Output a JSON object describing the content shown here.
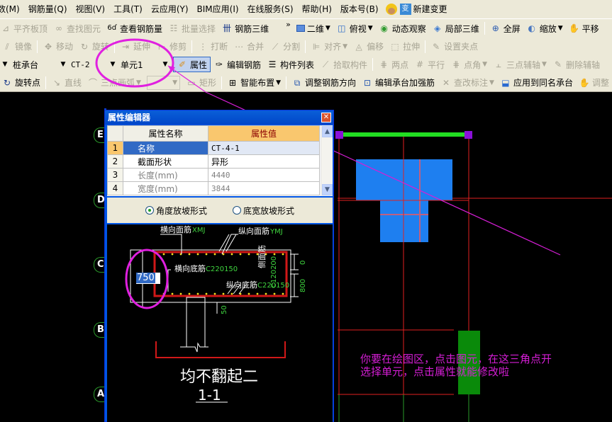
{
  "menubar": {
    "items": [
      "数(M)",
      "钢筋量(Q)",
      "视图(V)",
      "工具(T)",
      "云应用(Y)",
      "BIM应用(I)",
      "在线服务(S)",
      "帮助(H)",
      "版本号(B)"
    ],
    "new_change": "新建变更"
  },
  "toolbar1": {
    "items": [
      {
        "label": "平齐板顶",
        "icon": "align-top-icon",
        "disabled": true
      },
      {
        "label": "查找图元",
        "icon": "binoculars-icon",
        "disabled": true
      },
      {
        "label": "查看钢筋量",
        "icon": "glasses-icon",
        "disabled": false
      },
      {
        "label": "批量选择",
        "icon": "batch-select-icon",
        "disabled": true
      },
      {
        "label": "钢筋三维",
        "icon": "rebar-3d-icon",
        "disabled": false
      }
    ],
    "overflow": "»",
    "view_items": [
      {
        "label": "二维",
        "icon": "2d-icon",
        "dropdown": true
      },
      {
        "label": "俯视",
        "icon": "cube-icon",
        "dropdown": true
      },
      {
        "label": "动态观察",
        "icon": "orbit-icon",
        "dropdown": false
      },
      {
        "label": "局部三维",
        "icon": "local-3d-icon",
        "dropdown": false
      },
      {
        "label": "全屏",
        "icon": "fullscreen-icon",
        "dropdown": false
      },
      {
        "label": "缩放",
        "icon": "zoom-icon",
        "dropdown": true
      },
      {
        "label": "平移",
        "icon": "pan-icon",
        "dropdown": false
      }
    ]
  },
  "toolbar2": {
    "items": [
      {
        "label": "镜像",
        "icon": "mirror-icon"
      },
      {
        "label": "移动",
        "icon": "move-icon"
      },
      {
        "label": "旋转",
        "icon": "rotate-icon"
      },
      {
        "label": "延伸",
        "icon": "extend-icon"
      },
      {
        "label": "修剪",
        "icon": "trim-icon"
      },
      {
        "label": "打断",
        "icon": "break-icon"
      },
      {
        "label": "合并",
        "icon": "merge-icon"
      },
      {
        "label": "分割",
        "icon": "split-icon"
      },
      {
        "label": "对齐",
        "icon": "align-icon",
        "dropdown": true
      },
      {
        "label": "偏移",
        "icon": "offset-icon"
      },
      {
        "label": "拉伸",
        "icon": "stretch-icon"
      },
      {
        "label": "设置夹点",
        "icon": "grip-icon"
      }
    ]
  },
  "toolbar3": {
    "component_type": "桩承台",
    "component_name": "CT-2",
    "unit": "单元1",
    "items": [
      {
        "label": "属性",
        "icon": "properties-icon",
        "pressed": true,
        "disabled": false
      },
      {
        "label": "编辑钢筋",
        "icon": "edit-rebar-icon",
        "disabled": false
      },
      {
        "label": "构件列表",
        "icon": "component-list-icon",
        "disabled": false
      },
      {
        "label": "拾取构件",
        "icon": "pick-icon",
        "disabled": true
      },
      {
        "label": "两点",
        "icon": "two-point-icon",
        "disabled": true
      },
      {
        "label": "平行",
        "icon": "parallel-icon",
        "disabled": true
      },
      {
        "label": "点角",
        "icon": "point-angle-icon",
        "disabled": true,
        "dropdown": true
      },
      {
        "label": "三点辅轴",
        "icon": "three-point-axis-icon",
        "disabled": true,
        "dropdown": true
      },
      {
        "label": "删除辅轴",
        "icon": "delete-axis-icon",
        "disabled": true
      }
    ]
  },
  "toolbar4": {
    "items": [
      {
        "label": "旋转点",
        "icon": "rotate-point-icon",
        "disabled": false
      },
      {
        "label": "直线",
        "icon": "line-icon",
        "disabled": true
      },
      {
        "label": "三点画弧",
        "icon": "arc-icon",
        "disabled": true,
        "dropdown": true
      },
      {
        "label": "矩形",
        "icon": "rectangle-icon",
        "disabled": true
      },
      {
        "label": "智能布置",
        "icon": "smart-layout-icon",
        "disabled": false,
        "dropdown": true
      },
      {
        "label": "调整钢筋方向",
        "icon": "adjust-direction-icon",
        "disabled": false
      },
      {
        "label": "编辑承台加强筋",
        "icon": "edit-reinforce-icon",
        "disabled": false
      },
      {
        "label": "查改标注",
        "icon": "annotation-icon",
        "disabled": true,
        "dropdown": true
      },
      {
        "label": "应用到同名承台",
        "icon": "apply-same-icon",
        "disabled": false
      },
      {
        "label": "调整",
        "icon": "adjust-icon",
        "disabled": true
      }
    ]
  },
  "property_editor": {
    "title": "属性编辑器",
    "col_name": "属性名称",
    "col_value": "属性值",
    "rows": [
      {
        "num": "1",
        "name": "名称",
        "value": "CT-4-1",
        "selected": true,
        "grey": false
      },
      {
        "num": "2",
        "name": "截面形状",
        "value": "异形",
        "selected": false,
        "grey": false
      },
      {
        "num": "3",
        "name": "长度(mm)",
        "value": "4440",
        "selected": false,
        "grey": true
      },
      {
        "num": "4",
        "name": "宽度(mm)",
        "value": "3844",
        "selected": false,
        "grey": true
      }
    ],
    "radio_angle": "角度放坡形式",
    "radio_width": "底宽放坡形式",
    "radio_selected": "angle",
    "preview": {
      "top_transverse": "横向面筋",
      "top_transverse_code": "XMJ",
      "top_longitudinal": "纵向面筋",
      "top_longitudinal_code": "YMJ",
      "bottom_transverse": "横向底筋",
      "bottom_transverse_code": "C220150",
      "bottom_longitudinal": "纵向底筋",
      "bottom_longitudinal_code": "C220150",
      "side": "侧面筋",
      "side_code": "C120200",
      "dim_0": "0",
      "dim_800": "800",
      "dim_50": "50",
      "note": "均不翻起二",
      "section": "1-1",
      "input_value": "750"
    }
  },
  "canvas": {
    "axis_labels": [
      "E",
      "D",
      "C",
      "B",
      "A"
    ],
    "annotation_line1": "你要在绘图区，点击图元，在这三角点开",
    "annotation_line2": "选择单元，点击属性就能修改啦",
    "colors": {
      "footing": "#1e7ff0",
      "beam": "#22dd22",
      "column": "#0a8a0a",
      "grid": "#e02020",
      "annotation": "#d61ed6",
      "handle": "#8a10d8"
    }
  }
}
